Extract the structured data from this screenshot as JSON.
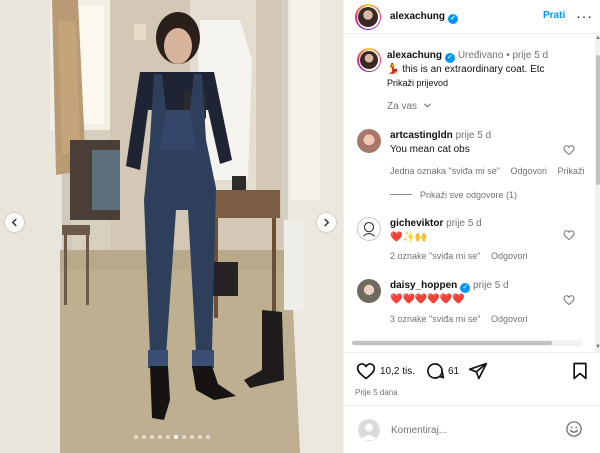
{
  "post": {
    "username": "alexachung",
    "follow_label": "Prati",
    "more_label": "···",
    "caption": {
      "username": "alexachung",
      "edited": "Uređivano",
      "separator": "•",
      "time": "prije 5 d",
      "emoji": "💃",
      "text": "this is an extraordinary coat. Etc",
      "translate": "Prikaži prijevod"
    },
    "for_you_label": "Za vas"
  },
  "comments": [
    {
      "username": "artcastingldn",
      "time": "prije 5 d",
      "text": "You mean cat obs",
      "likes": "Jedna oznaka \"sviđa mi se\"",
      "reply": "Odgovori",
      "extra": "Prikaži",
      "view_replies": "Prikaži sve odgovore (1)"
    },
    {
      "username": "gicheviktor",
      "time": "prije 5 d",
      "text": "❤️✨🙌",
      "likes": "2 oznake \"sviđa mi se\"",
      "reply": "Odgovori"
    },
    {
      "username": "daisy_hoppen",
      "time": "prije 5 d",
      "text": "❤️❤️❤️❤️❤️❤️",
      "likes": "3 oznake \"sviđa mi se\"",
      "reply": "Odgovori"
    }
  ],
  "stats": {
    "likes": "10,2 tis.",
    "comments": "61",
    "date": "Prije 5 dana"
  },
  "composer": {
    "placeholder": "Komentiraj..."
  },
  "carousel": {
    "slide_count": 10,
    "active_index": 5
  },
  "icons": {
    "prev": "chevron-left-icon",
    "next": "chevron-right-icon",
    "like": "heart-icon",
    "comment": "comment-bubble-icon",
    "share": "paper-plane-icon",
    "save": "bookmark-icon",
    "emoji": "smiley-icon",
    "verified": "verified-badge-icon"
  },
  "colors": {
    "accent": "#0095f6",
    "muted": "#737373",
    "like_red": "#ed4956"
  }
}
